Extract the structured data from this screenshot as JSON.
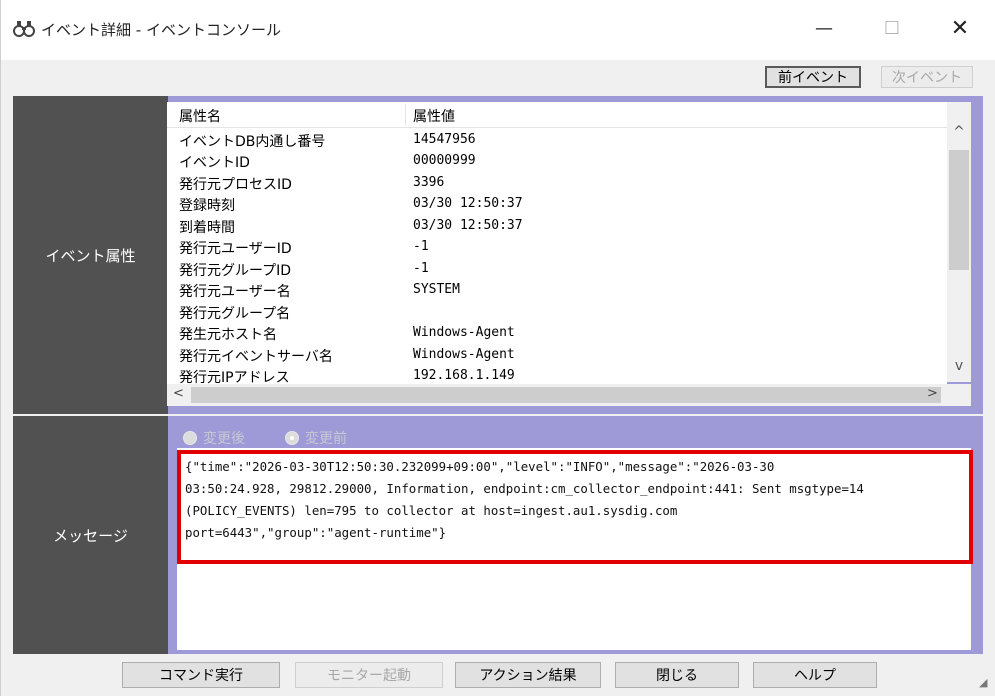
{
  "window": {
    "title": "イベント詳細 - イベントコンソール",
    "minimize_glyph": "—",
    "maximize_glyph": "☐",
    "close_glyph": "✕",
    "icon": "binoculars-icon"
  },
  "nav": {
    "prev_label": "前イベント",
    "next_label": "次イベント"
  },
  "attributes": {
    "section_label": "イベント属性",
    "headers": {
      "name": "属性名",
      "value": "属性値"
    },
    "rows": [
      {
        "name": "イベントDB内通し番号",
        "value": "14547956"
      },
      {
        "name": "イベントID",
        "value": "00000999"
      },
      {
        "name": "発行元プロセスID",
        "value": "3396"
      },
      {
        "name": "登録時刻",
        "value": "03/30 12:50:37"
      },
      {
        "name": "到着時間",
        "value": "03/30 12:50:37"
      },
      {
        "name": "発行元ユーザーID",
        "value": "-1"
      },
      {
        "name": "発行元グループID",
        "value": "-1"
      },
      {
        "name": "発行元ユーザー名",
        "value": "SYSTEM"
      },
      {
        "name": "発行元グループ名",
        "value": ""
      },
      {
        "name": "発生元ホスト名",
        "value": "Windows-Agent"
      },
      {
        "name": "発行元イベントサーバ名",
        "value": "Windows-Agent"
      },
      {
        "name": "発行元IPアドレス",
        "value": "192.168.1.149"
      }
    ],
    "scroll_up": "^",
    "scroll_down": "v",
    "scroll_left": "<",
    "scroll_right": ">"
  },
  "message": {
    "section_label": "メッセージ",
    "radio_after": "変更後",
    "radio_before": "変更前",
    "lines": [
      "{\"time\":\"2026-03-30T12:50:30.232099+09:00\",\"level\":\"INFO\",\"message\":\"2026-03-30",
      "03:50:24.928, 29812.29000, Information, endpoint:cm_collector_endpoint:441: Sent msgtype=14",
      "(POLICY_EVENTS) len=795 to collector at host=ingest.au1.sysdig.com",
      "port=6443\",\"group\":\"agent-runtime\"}"
    ],
    "highlight_color": "#e00000"
  },
  "footer": {
    "command_exec": "コマンド実行",
    "monitor_start": "モニター起動",
    "action_result": "アクション結果",
    "close": "閉じる",
    "help": "ヘルプ"
  },
  "colors": {
    "panel_bg": "#9d9ad7",
    "label_bg": "#515151"
  }
}
